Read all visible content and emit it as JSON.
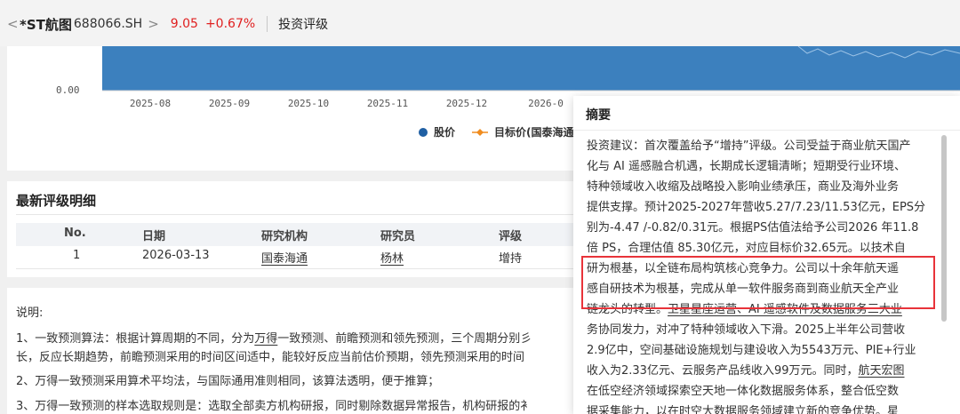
{
  "header": {
    "back_glyph": "<",
    "stock_name": "*ST航图",
    "stock_code": "688066.SH",
    "chevron_glyph": ">",
    "price": "9.05",
    "change": "+0.67%",
    "tab": "投资评级"
  },
  "chart_data": {
    "type": "area",
    "y_tick": "0.00",
    "x_ticks": [
      "2025-08",
      "2025-09",
      "2025-10",
      "2025-11",
      "2025-12",
      "2026-0"
    ],
    "legend": [
      {
        "label": "股价",
        "color": "#1f5fa3"
      },
      {
        "label": "目标价(国泰海通",
        "color": "#f08c1e"
      }
    ],
    "fill_color": "#3c80be"
  },
  "rating_detail": {
    "title": "最新评级明细",
    "columns": [
      "No.",
      "日期",
      "研究机构",
      "研究员",
      "评级"
    ],
    "rows": [
      [
        "1",
        "2026-03-13",
        "国泰海通",
        "杨林",
        "增持"
      ]
    ]
  },
  "notes": {
    "title": "说明:",
    "n1_a": "1、一致预测算法：根据计算周期的不同，分为",
    "n1_u": "万得",
    "n1_b": "一致预测、前瞻预测和领先预测，三个周期分别彡",
    "n1_c": "长，反应长期趋势，前瞻预测采用的时间区间适中，能较好反应当前估价预期，领先预测采用的时间",
    "n2": "2、万得一致预测采用算术平均法，与国际通用准则相同，该算法透明，便于推算；",
    "n3": "3、万得一致预测的样本选取规则是：选取全部卖方机构研报，同时剔除数据异常报告，机构研报的衤"
  },
  "summary_popup": {
    "title": "摘要",
    "l1": "投资建议：首次覆盖给予“增持”评级。公司受益于商业航天国产",
    "l2": "化与 AI 遥感融合机遇，长期成长逻辑清晰；短期受行业环境、",
    "l3": "特种领域收入收缩及战略投入影响业绩承压，商业及海外业务",
    "l4": "提供支撑。预计2025-2027年营收5.27/7.23/11.53亿元，EPS分",
    "l5": "别为-4.47 /-0.82/0.31元。根据PS估值法给予公司2026 年11.8",
    "l6": "倍 PS，合理估值 85.30亿元，对应目标价32.65元。以技术自",
    "l7": "研为根基，以全链布局构筑核心竞争力。公司以十余年航天遥",
    "l8": "感自研技术为根基，完成从单一软件服务商到商业航天全产业",
    "l9a": "链龙头的转型。",
    "l9u": "卫星星座运营、AI 遥感软件及数据服务三大业",
    "l10": "务协同发力，对冲了特种领域收入下滑。2025上半年公司营收",
    "l11": "2.9亿中，空间基础设施规划与建设收入为5543万元、PIE+行业",
    "l12a": "收入为2.33亿元、云服务产品线收入99万元。同时，",
    "l12u": "航天宏图",
    "l13": "在低空经济领域探索空天地一体化数据服务体系，整合低空数",
    "l14": "据采集能力，以在时空大数据服务领域建立新的竞争优势。星"
  }
}
